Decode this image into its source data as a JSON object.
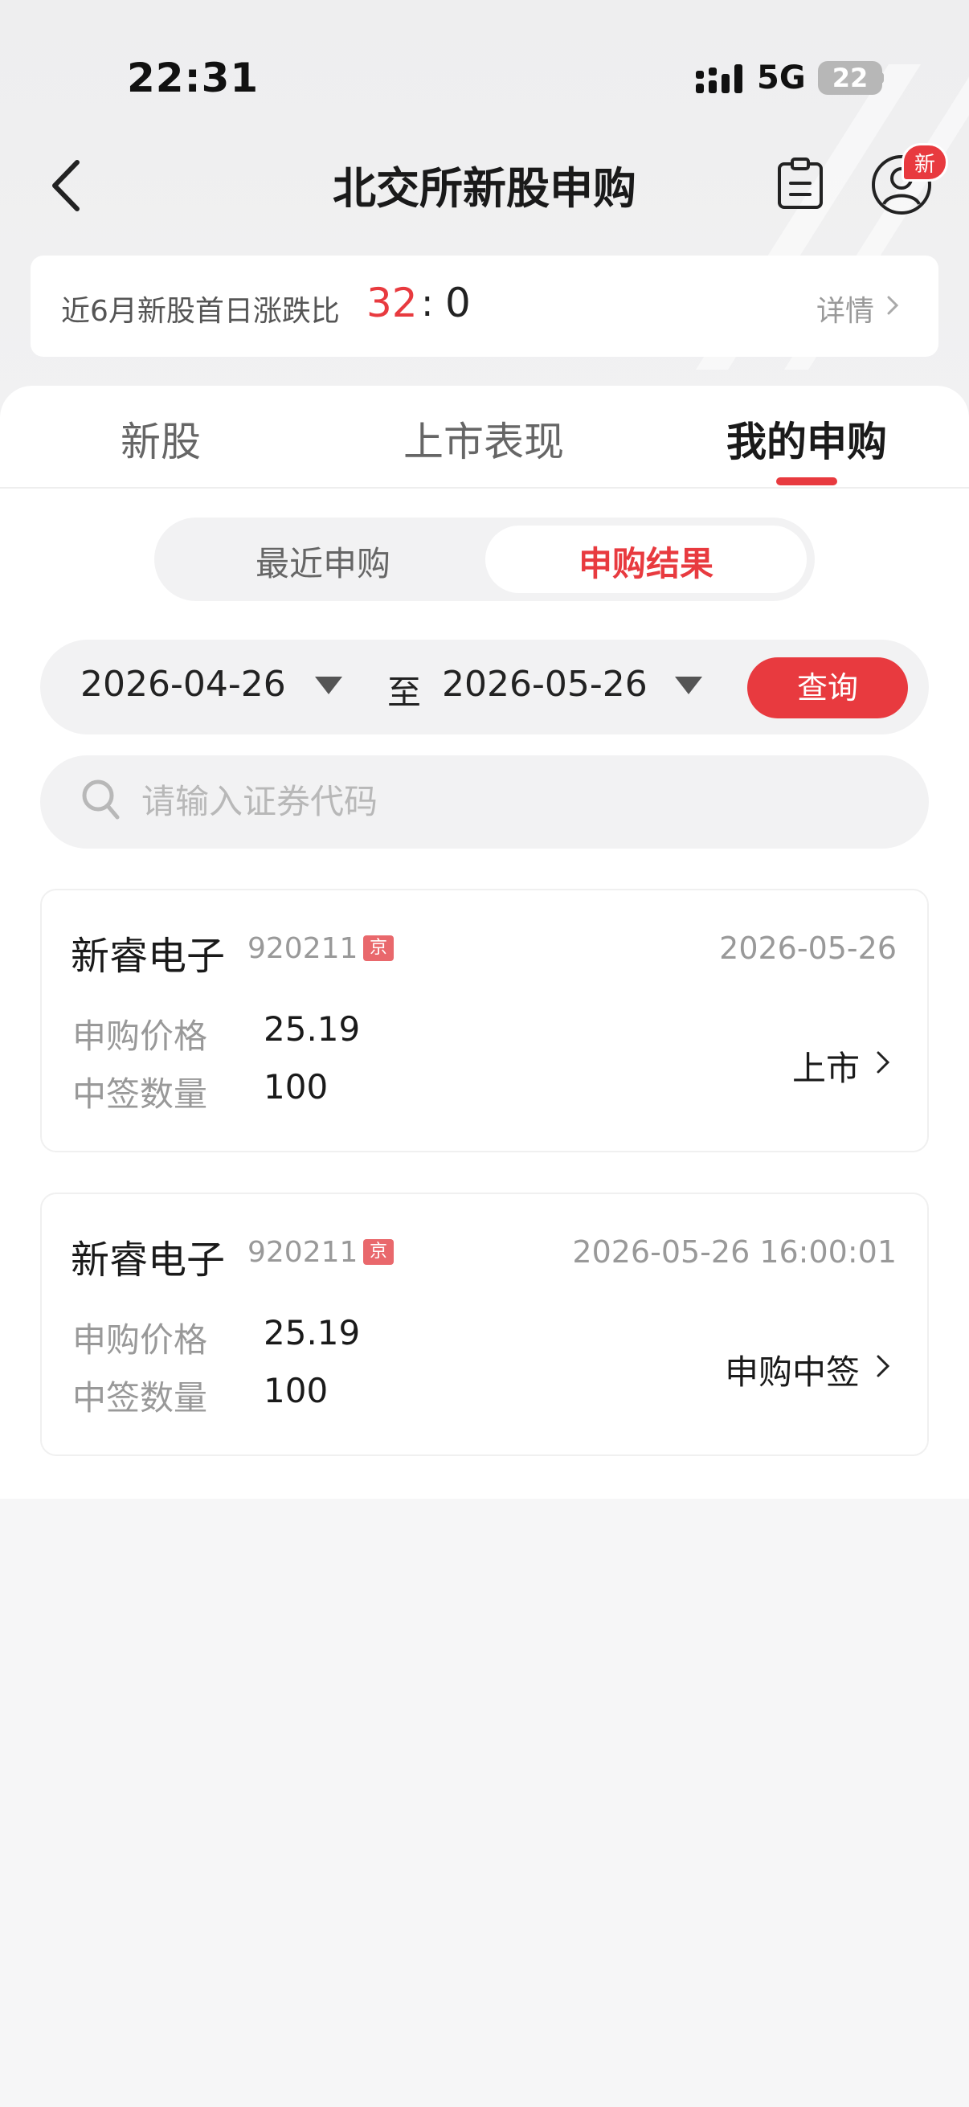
{
  "status_bar": {
    "time": "22:31",
    "network": "5G",
    "battery": "22"
  },
  "nav": {
    "title": "北交所新股申购",
    "avatar_badge": "新"
  },
  "ratio_banner": {
    "label": "近6月新股首日涨跌比",
    "up": "32",
    "separator": ":",
    "down": "0",
    "detail": "详情"
  },
  "tabs": [
    {
      "label": "新股",
      "active": false
    },
    {
      "label": "上市表现",
      "active": false
    },
    {
      "label": "我的申购",
      "active": true
    }
  ],
  "segments": [
    {
      "label": "最近申购",
      "active": false
    },
    {
      "label": "申购结果",
      "active": true
    }
  ],
  "filter": {
    "start_date": "2026-04-26",
    "to": "至",
    "end_date": "2026-05-26",
    "query_label": "查询"
  },
  "search": {
    "placeholder": "请输入证券代码",
    "value": ""
  },
  "results": [
    {
      "name": "新睿电子",
      "code": "920211",
      "market": "京",
      "date": "2026-05-26",
      "price_label": "申购价格",
      "price": "25.19",
      "qty_label": "中签数量",
      "qty": "100",
      "status": "上市"
    },
    {
      "name": "新睿电子",
      "code": "920211",
      "market": "京",
      "date": "2026-05-26 16:00:01",
      "price_label": "申购价格",
      "price": "25.19",
      "qty_label": "中签数量",
      "qty": "100",
      "status": "申购中签"
    }
  ],
  "colors": {
    "accent": "#e83a3f",
    "muted": "#999999",
    "page_bg": "#f6f6f7"
  }
}
